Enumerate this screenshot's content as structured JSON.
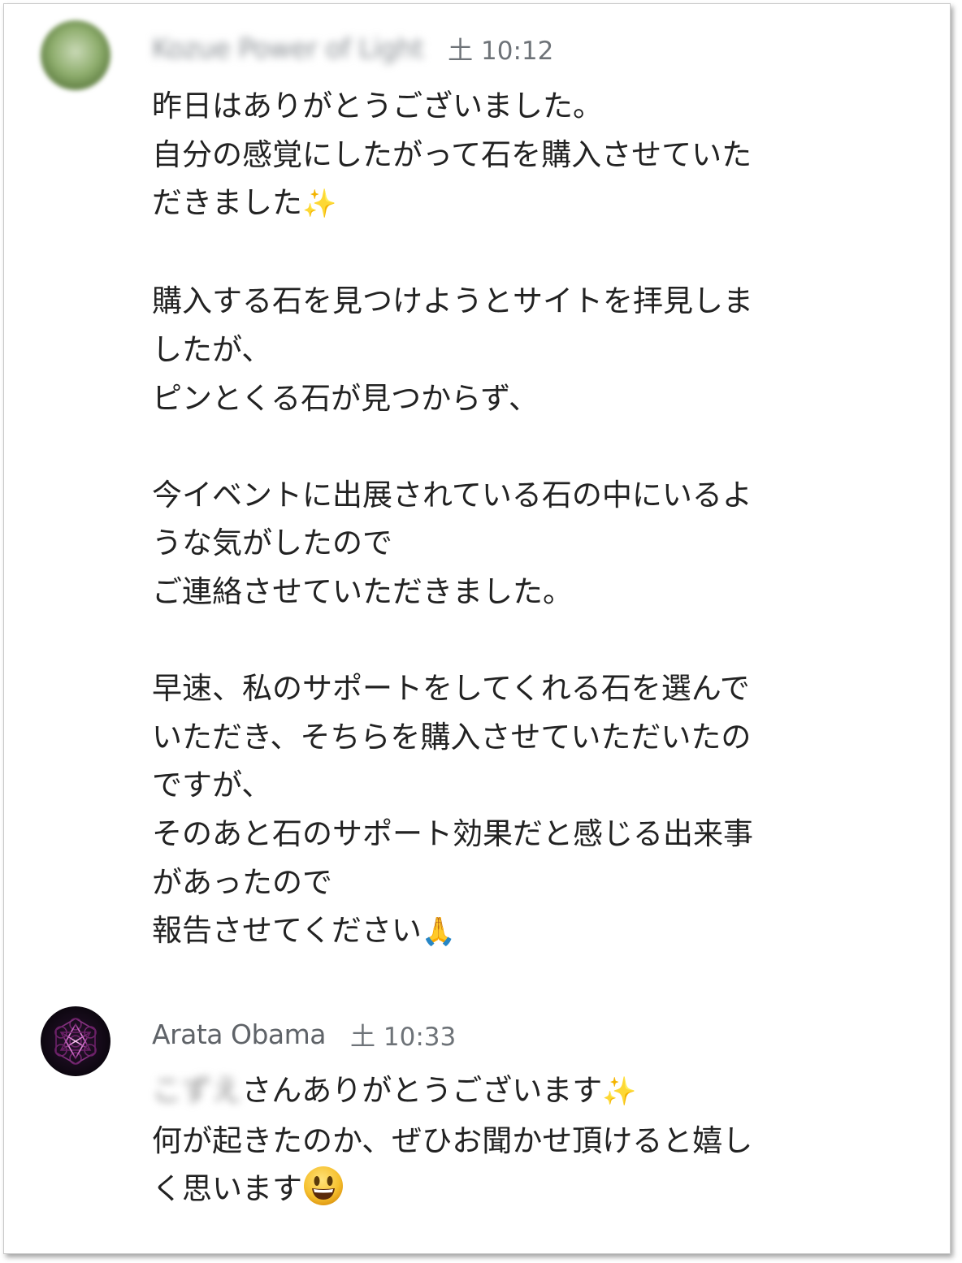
{
  "messages": [
    {
      "sender": "Kozue Power of Light",
      "time": "土 10:12",
      "lines": [
        "昨日はありがとうございました。",
        "自分の感覚にしたがって石を購入させていた",
        "だきました",
        "",
        "購入する石を見つけようとサイトを拝見しま",
        "したが、",
        "ピンとくる石が見つからず、",
        "",
        "今イベントに出展されている石の中にいるよ",
        "うな気がしたので",
        "ご連絡させていただきました。",
        "",
        "早速、私のサポートをしてくれる石を選んで",
        "いただき、そちらを購入させていただいたの",
        "ですが、",
        "そのあと石のサポート効果だと感じる出来事",
        "があったので",
        "報告させてください"
      ],
      "emoji": {
        "line3": "sparkles-emoji",
        "last": "folded-hands-emoji"
      }
    },
    {
      "sender": "Arata Obama",
      "time": "土 10:33",
      "blurred_name": "こずえ",
      "lines": [
        "さんありがとうございます",
        "何が起きたのか、ぜひお聞かせ頂けると嬉し",
        "く思います"
      ],
      "emoji": {
        "line1": "sparkles-emoji",
        "last": "smiling-face-emoji"
      }
    }
  ],
  "glyphs": {
    "sparkles": "✨",
    "pray": "🙏"
  }
}
